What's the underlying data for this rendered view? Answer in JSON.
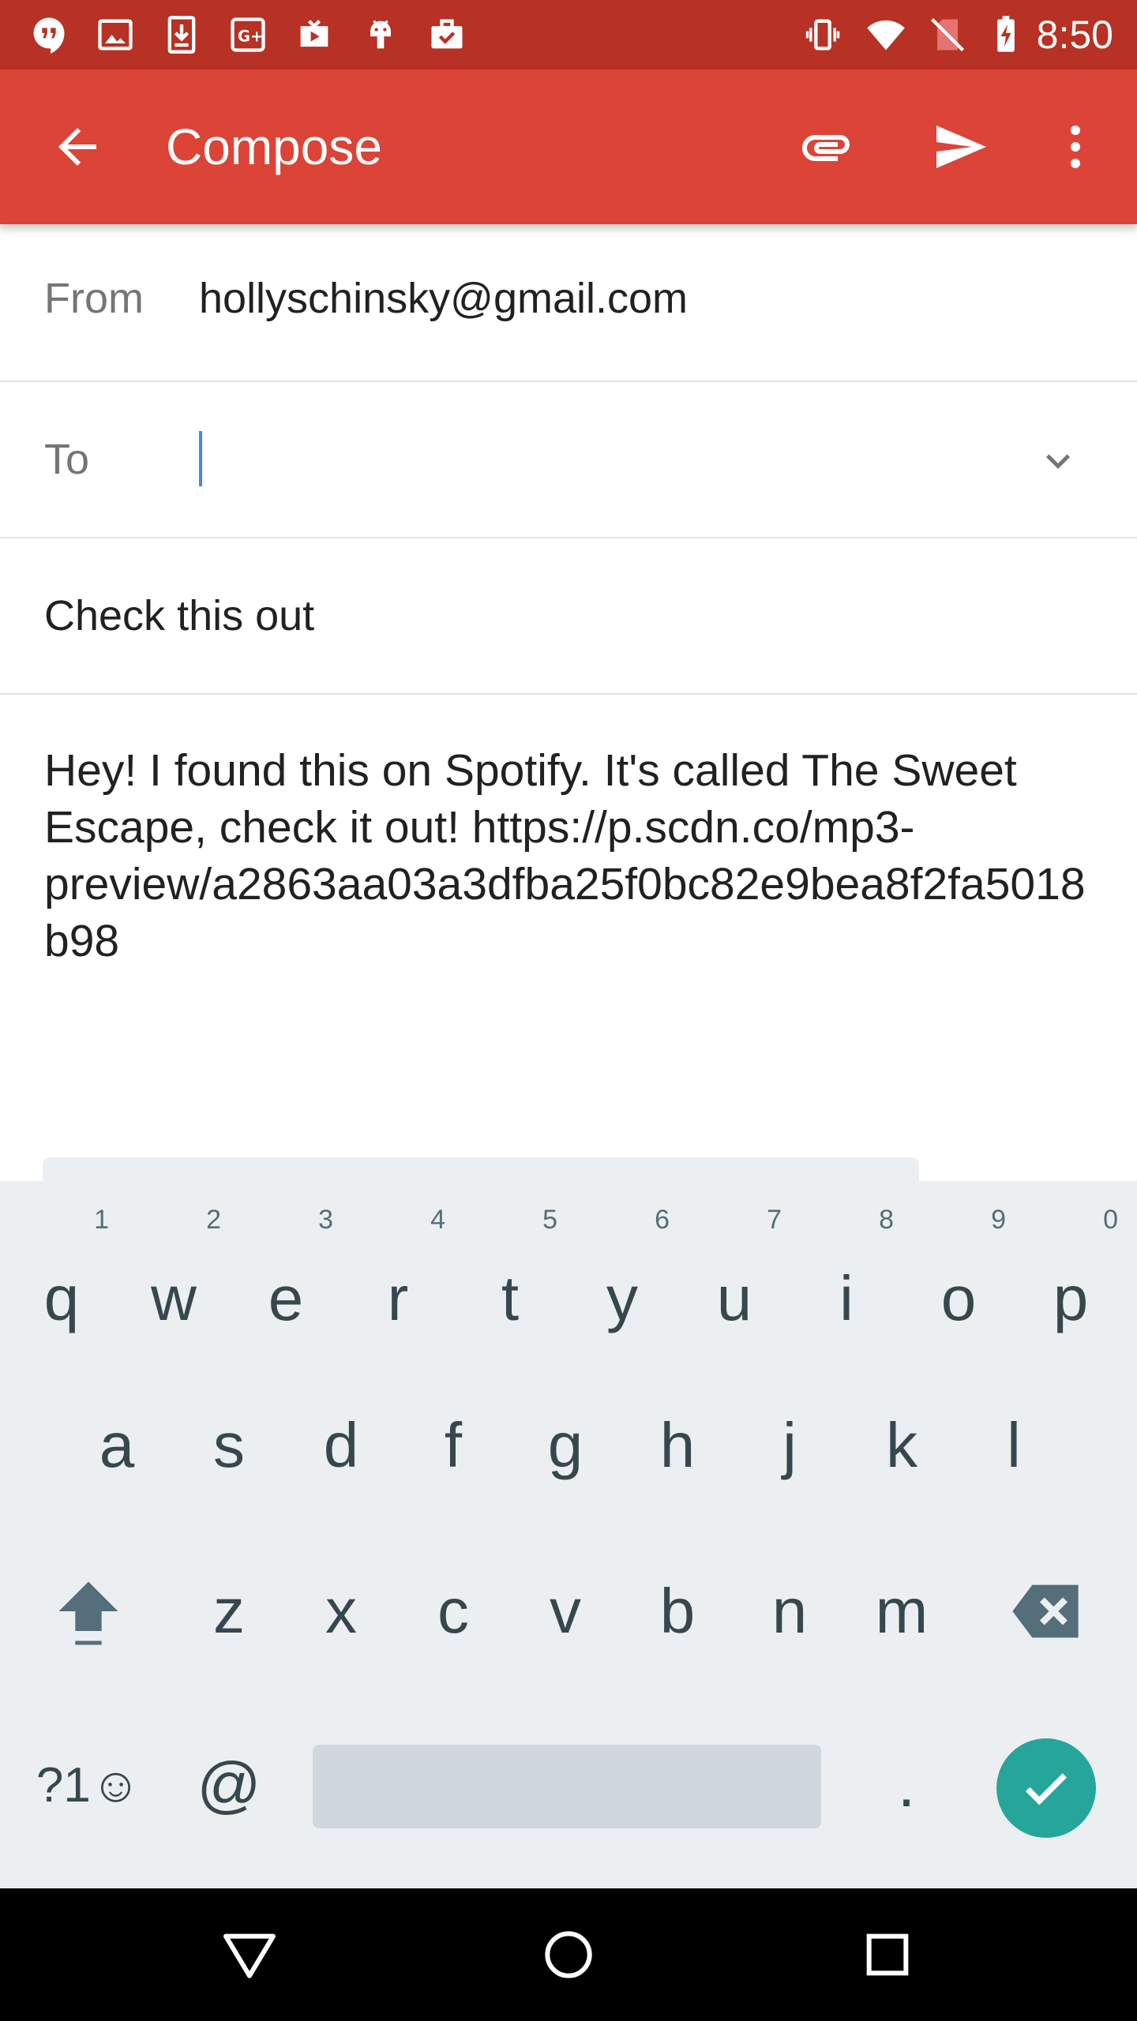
{
  "status_bar": {
    "time": "8:50",
    "notification_icons": [
      "hangouts-icon",
      "photos-icon",
      "download-icon",
      "google-plus-icon",
      "youtube-icon",
      "android-icon",
      "briefcase-check-icon"
    ],
    "system_icons": [
      "vibrate-icon",
      "wifi-icon",
      "no-sim-icon",
      "battery-charging-icon"
    ]
  },
  "app_bar": {
    "title": "Compose",
    "back_icon": "arrow-back-icon",
    "attach_icon": "paperclip-icon",
    "send_icon": "send-icon",
    "more_icon": "more-vert-icon"
  },
  "compose": {
    "from_label": "From",
    "from_value": "hollyschinsky@gmail.com",
    "to_label": "To",
    "to_value": "",
    "subject": "Check this out",
    "body": "Hey! I found this on Spotify. It's called The Sweet Escape, check it out! https://p.scdn.co/mp3-preview/a2863aa03a3dfba25f0bc82e9bea8f2fa5018b98"
  },
  "keyboard": {
    "row1": [
      {
        "key": "q",
        "hint": "1"
      },
      {
        "key": "w",
        "hint": "2"
      },
      {
        "key": "e",
        "hint": "3"
      },
      {
        "key": "r",
        "hint": "4"
      },
      {
        "key": "t",
        "hint": "5"
      },
      {
        "key": "y",
        "hint": "6"
      },
      {
        "key": "u",
        "hint": "7"
      },
      {
        "key": "i",
        "hint": "8"
      },
      {
        "key": "o",
        "hint": "9"
      },
      {
        "key": "p",
        "hint": "0"
      }
    ],
    "row2": [
      "a",
      "s",
      "d",
      "f",
      "g",
      "h",
      "j",
      "k",
      "l"
    ],
    "row3": [
      "z",
      "x",
      "c",
      "v",
      "b",
      "n",
      "m"
    ],
    "symbols_key": "?1☺",
    "at_key": "@",
    "period_key": "."
  },
  "nav_bar": {
    "back": "nav-back-icon",
    "home": "nav-home-icon",
    "recents": "nav-recents-icon"
  }
}
